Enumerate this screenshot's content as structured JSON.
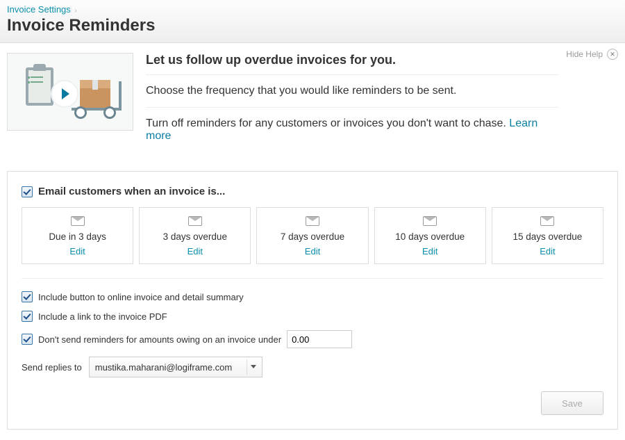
{
  "breadcrumb": {
    "parent": "Invoice Settings",
    "title": "Invoice Reminders"
  },
  "hide_help": {
    "label": "Hide Help"
  },
  "help": {
    "heading": "Let us follow up overdue invoices for you.",
    "line1": "Choose the frequency that you would like reminders to be sent.",
    "line2_pre": "Turn off reminders for any customers or invoices you don't want to chase. ",
    "learn_more": "Learn more"
  },
  "section": {
    "heading": "Email customers when an invoice is..."
  },
  "cards": [
    {
      "label": "Due in 3 days",
      "edit": "Edit"
    },
    {
      "label": "3 days overdue",
      "edit": "Edit"
    },
    {
      "label": "7 days overdue",
      "edit": "Edit"
    },
    {
      "label": "10 days overdue",
      "edit": "Edit"
    },
    {
      "label": "15 days overdue",
      "edit": "Edit"
    }
  ],
  "options": {
    "include_button": {
      "label": "Include button to online invoice and detail summary",
      "checked": true
    },
    "include_pdf": {
      "label": "Include a link to the invoice PDF",
      "checked": true
    },
    "min_amount": {
      "label": "Don't send reminders for amounts owing on an invoice under",
      "checked": true,
      "value": "0.00"
    }
  },
  "reply": {
    "label": "Send replies to",
    "value": "mustika.maharani@logiframe.com"
  },
  "buttons": {
    "save": "Save"
  }
}
